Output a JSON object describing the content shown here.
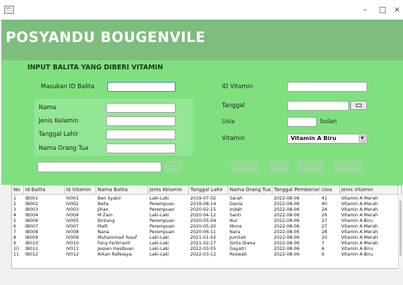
{
  "window": {
    "minimize": "–",
    "maximize": "□",
    "close": "×"
  },
  "header": {
    "title": "POSYANDU BOUGENVILE"
  },
  "section": {
    "title": "INPUT BALITA YANG DIBERI VITAMIN"
  },
  "form": {
    "id_balita_label": "Masukan ID Balita",
    "nama_label": "Nama",
    "jenis_kelamin_label": "Jenis Kelamin",
    "tanggal_lahir_label": "Tanggal Lahir",
    "nama_ortu_label": "Nama Orang Tua",
    "id_vitamin_label": "ID Vitamin",
    "tanggal_label": "Tanggal",
    "usia_label": "Usia",
    "usia_unit": "bulan",
    "vitamin_label": "Vitamin",
    "vitamin_selected": "Vitamin A Biru"
  },
  "buttons": {
    "cari": "CARI",
    "simpan": "SIMPAN",
    "edit": "EDIT",
    "hapus": "HAPUS",
    "keluar": "KELUAR"
  },
  "colors": {
    "header": "#7dbd7d",
    "form_bg": "#80e080",
    "group_box": "#93e693"
  },
  "icons": {
    "date_picker": "calendar-icon",
    "dropdown": "chevron-down-icon",
    "app": "window-app-icon"
  },
  "table": {
    "columns": [
      "No",
      "Id Balita",
      "Id Vitamin",
      "Nama Balita",
      "Jenis Kelamin",
      "Tanggal Lahir",
      "Nama Orang Tua",
      "Tanggal Pemberian",
      "Usia",
      "Jenis Vitamin"
    ],
    "rows": [
      [
        "1",
        "IB001",
        "IV001",
        "Ben Syakir",
        "Laki-Laki",
        "2019-07-02",
        "Sarah",
        "2022-08-06",
        "41",
        "Vitamin A Merah"
      ],
      [
        "2",
        "IB002",
        "IV002",
        "Bella",
        "Perempuan",
        "2019-08-14",
        "Dania",
        "2022-08-06",
        "40",
        "Vitamin A Merah"
      ],
      [
        "3",
        "IB003",
        "IV003",
        "Jihan",
        "Perempuan",
        "2020-02-15",
        "Indah",
        "2022-08-06",
        "24",
        "Vitamin A Merah"
      ],
      [
        "4",
        "IB004",
        "IV004",
        "M Zain",
        "Laki-Laki",
        "2020-04-12",
        "Santi",
        "2022-08-06",
        "26",
        "Vitamin A Merah"
      ],
      [
        "5",
        "IB006",
        "IV005",
        "Bintang",
        "Perempuan",
        "2020-05-04",
        "Nur",
        "2022-08-06",
        "27",
        "Vitamin A Biru"
      ],
      [
        "6",
        "IB007",
        "IV007",
        "Malli",
        "Perempuan",
        "2020-05-20",
        "Mona",
        "2022-08-06",
        "27",
        "Vitamin A Merah"
      ],
      [
        "7",
        "IB008",
        "IV008",
        "Nana",
        "Perempuan",
        "2020-06-11",
        "Nara",
        "2022-08-06",
        "28",
        "Vitamin A Merah"
      ],
      [
        "8",
        "IB009",
        "IV009",
        "Muhammad Yusuf",
        "Laki-Laki",
        "2021-01-02",
        "Jumilah",
        "2022-08-06",
        "20",
        "Vitamin A Merah"
      ],
      [
        "9",
        "IB010",
        "IV010",
        "Fany Ferbrianti",
        "Laki-Laki",
        "2021-02-17",
        "Sinta Diana",
        "2022-08-06",
        "7",
        "Vitamin A Merah"
      ],
      [
        "10",
        "IB011",
        "IV011",
        "Jessen Hasibuan",
        "Laki-Laki",
        "2022-03-05",
        "Gayatri",
        "2022-08-06",
        "6",
        "Vitamin A Biru"
      ],
      [
        "11",
        "IB012",
        "IV012",
        "Arkan Rafessya",
        "Laki-Laki",
        "2022-03-12",
        "Roswati",
        "2022-08-06",
        "6",
        "Vitamin A Biru"
      ]
    ]
  }
}
